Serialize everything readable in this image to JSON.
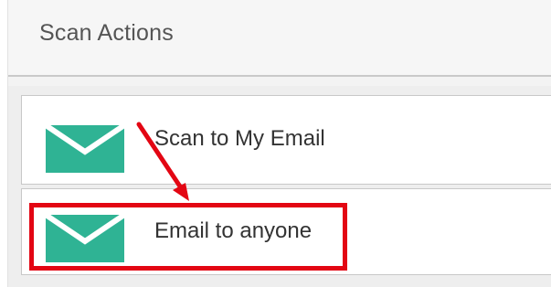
{
  "panel": {
    "title": "Scan Actions"
  },
  "actions": [
    {
      "label": "Scan to My Email",
      "icon": "envelope-icon"
    },
    {
      "label": "Email to anyone",
      "icon": "envelope-icon"
    }
  ],
  "colors": {
    "icon_fill": "#2fb394",
    "icon_fold": "#ffffff",
    "annotation": "#e30613"
  }
}
